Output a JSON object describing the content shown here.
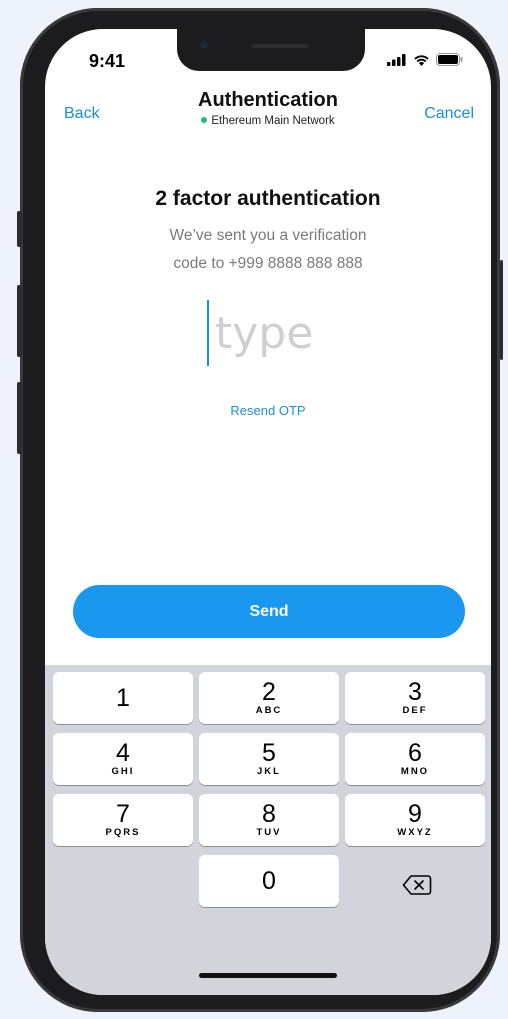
{
  "status_bar": {
    "time": "9:41"
  },
  "nav": {
    "back_label": "Back",
    "title": "Authentication",
    "network": "Ethereum Main Network",
    "cancel_label": "Cancel"
  },
  "main": {
    "heading": "2 factor authentication",
    "subtext_line1": "We’ve sent you a verification",
    "subtext_line2": "code to +999 8888 888 888",
    "code_placeholder": "type",
    "resend_label": "Resend OTP",
    "send_label": "Send"
  },
  "keypad": {
    "keys": [
      {
        "digit": "1",
        "letters": ""
      },
      {
        "digit": "2",
        "letters": "ABC"
      },
      {
        "digit": "3",
        "letters": "DEF"
      },
      {
        "digit": "4",
        "letters": "GHI"
      },
      {
        "digit": "5",
        "letters": "JKL"
      },
      {
        "digit": "6",
        "letters": "MNO"
      },
      {
        "digit": "7",
        "letters": "PQRS"
      },
      {
        "digit": "8",
        "letters": "TUV"
      },
      {
        "digit": "9",
        "letters": "WXYZ"
      },
      {
        "digit": "0",
        "letters": ""
      }
    ],
    "backspace_icon": "backspace-icon"
  },
  "colors": {
    "accent": "#1a8fd6",
    "send_button": "#1a98f0",
    "network_dot": "#29b67a",
    "keyboard_bg": "#d1d4da"
  }
}
